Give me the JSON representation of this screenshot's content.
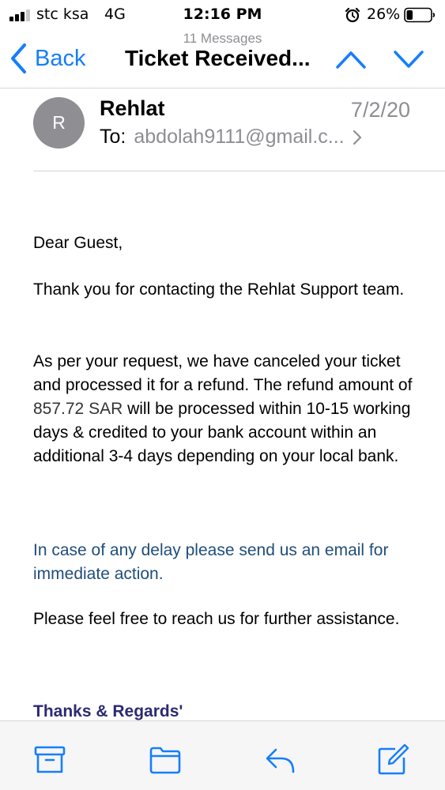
{
  "status_bar": {
    "carrier": "stc ksa",
    "network": "4G",
    "time": "12:16 PM",
    "battery_percent": "26%",
    "icons": [
      "signal-icon",
      "alarm-icon",
      "battery-icon"
    ]
  },
  "nav": {
    "message_count": "11 Messages",
    "back_label": "Back",
    "title": "Ticket Received...",
    "icons": [
      "chevron-left-icon",
      "chevron-up-icon",
      "chevron-down-icon"
    ]
  },
  "header": {
    "avatar_initial": "R",
    "sender": "Rehlat",
    "date": "7/2/20",
    "to_label": "To:",
    "to_address": "abdolah9111@gmail.c...",
    "icons": [
      "chevron-right-icon"
    ]
  },
  "body": {
    "greeting": "Dear Guest,",
    "thanks": "Thank you for contacting the Rehlat Support team.",
    "request_before": "As per your request, we have canceled your ticket and processed it for a refund.  The refund amount of ",
    "refund_amount": "857.72 SAR",
    "request_after": "  will be processed within 10-15 working days & credited to your bank account within an additional 3-4 days depending on your local bank.",
    "delay": "In case of any delay please send us an email for immediate action.",
    "assist": "Please feel free to reach us for further assistance.",
    "signoff": "Thanks & Regards'"
  },
  "toolbar": {
    "icons": [
      "archive-icon",
      "folder-icon",
      "reply-icon",
      "compose-icon"
    ]
  },
  "colors": {
    "accent": "#157efb",
    "secondary_text": "#8e8e93",
    "delay_text": "#1f4e79",
    "signoff_text": "#2c2a72",
    "avatar_bg": "#8e8e93"
  },
  "battery_level": 0.26
}
